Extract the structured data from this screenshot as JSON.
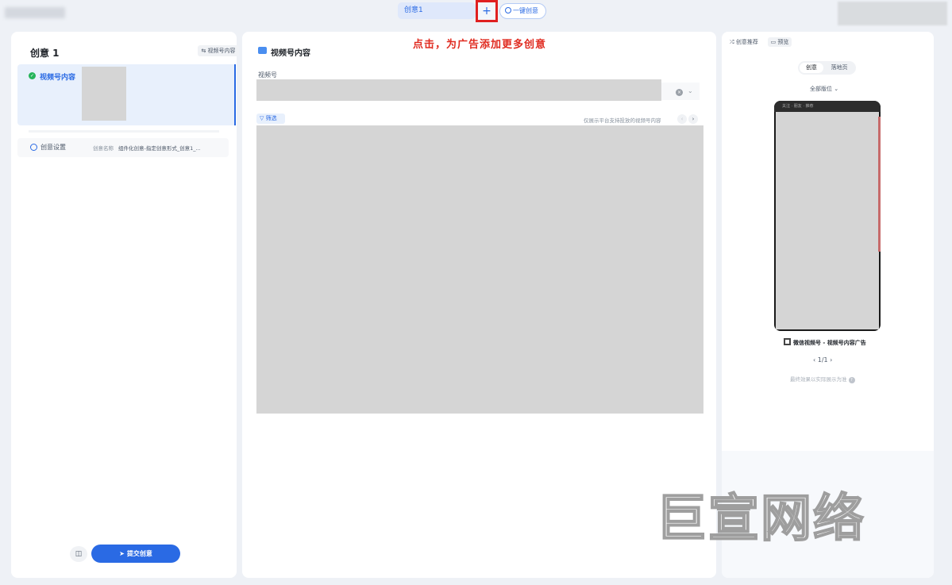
{
  "topbar": {
    "tab_label": "创意1",
    "add_label": "+",
    "one_key_label": "一键创意"
  },
  "annotation": {
    "hint": "点击，为广告添加更多创意"
  },
  "left": {
    "title": "创意 1",
    "video_content_btn": "视频号内容",
    "active_item_label": "视频号内容",
    "settings_label": "创意设置",
    "settings_name_key": "创意名称",
    "settings_name_value": "组件化创意-指定创意形式_创意1_...",
    "submit_label": "提交创意"
  },
  "middle": {
    "section_title": "视频号内容",
    "field_label": "视频号",
    "filter_label": "筛选",
    "filter_note": "仅展示平台支持投放的视频号内容"
  },
  "right": {
    "recommend_label": "创意推荐",
    "preview_label": "预览",
    "seg_creative": "创意",
    "seg_landing": "落地页",
    "position_label": "全部版位",
    "phone_top_text": "关注 · 朋友 · 推荐",
    "caption": "微信视频号 - 视频号内容广告",
    "pager": "1/1",
    "note": "最终效果以实际展示为准"
  },
  "watermark": {
    "text": "巨宣网络"
  },
  "colors": {
    "accent": "#2a6ae4",
    "hint_red": "#e02b20",
    "success": "#26b45a"
  }
}
